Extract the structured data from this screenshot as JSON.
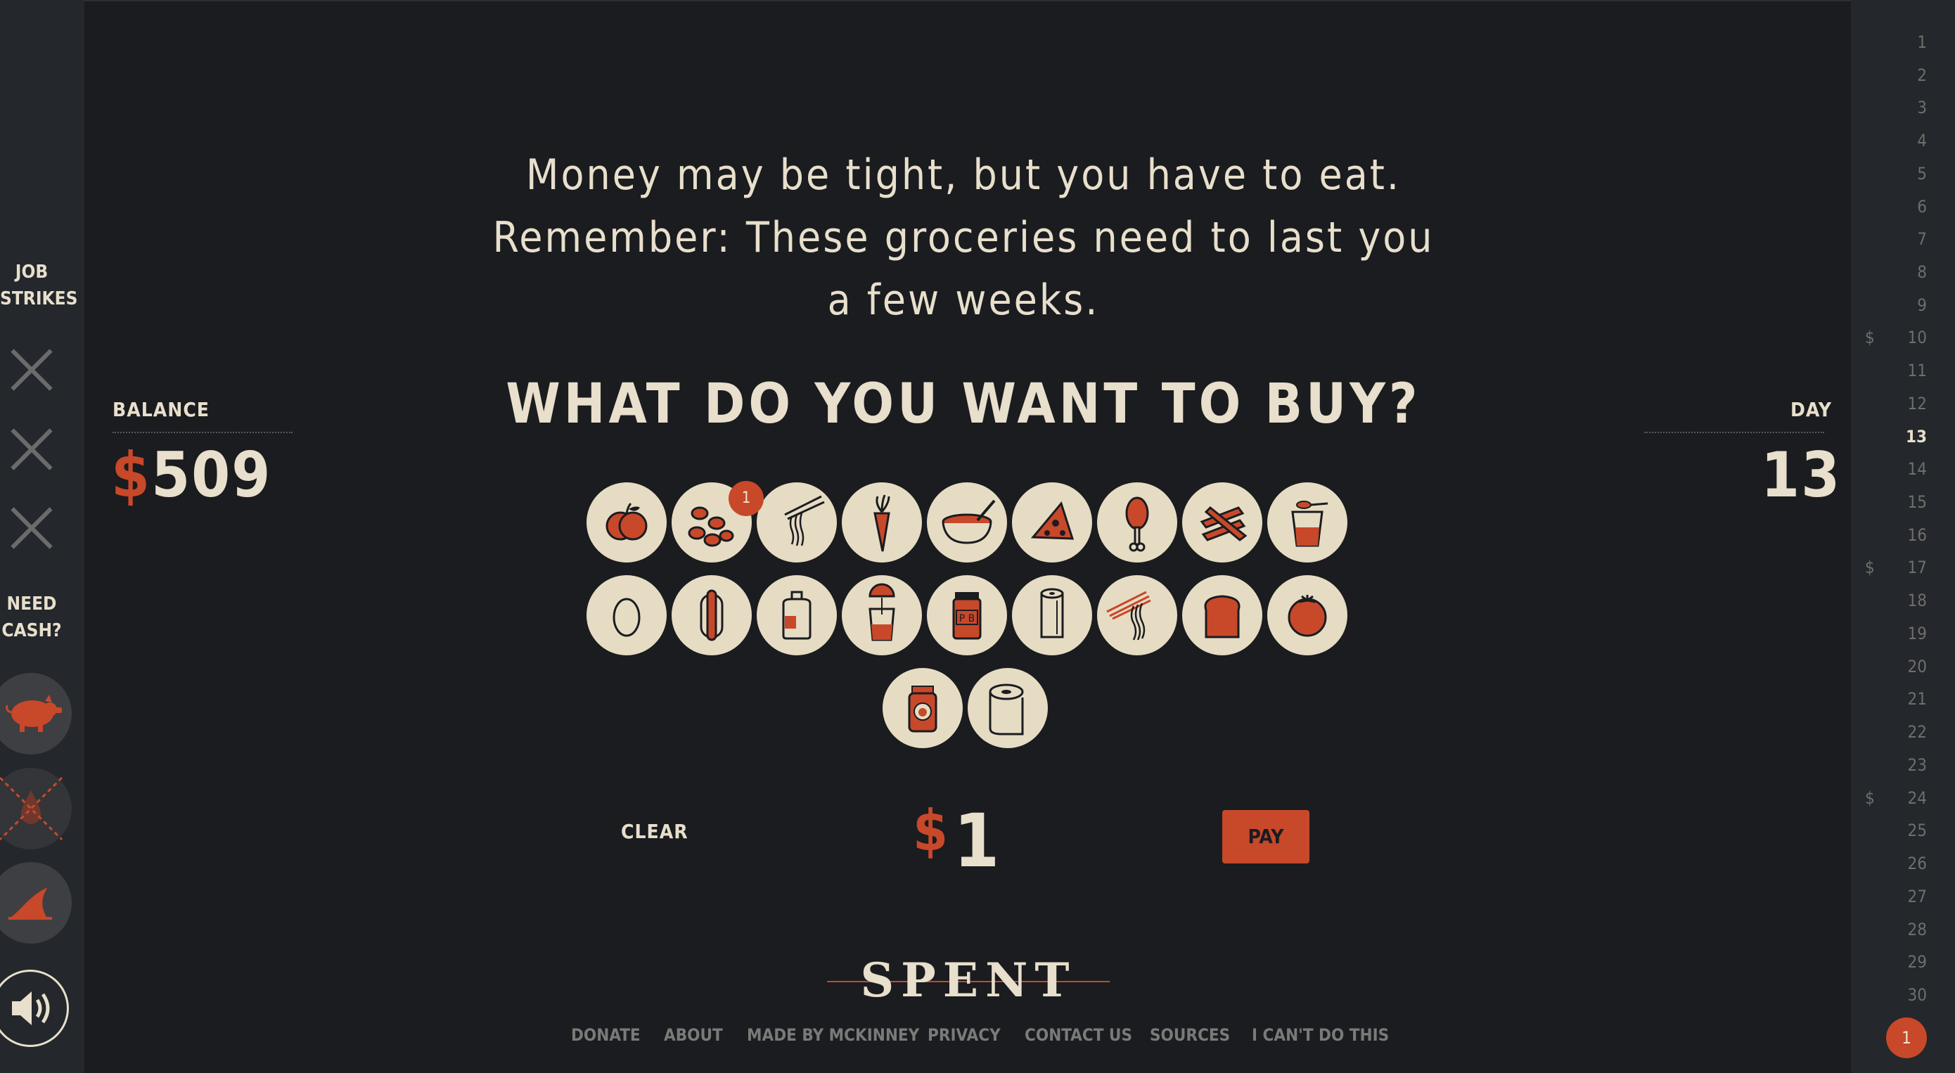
{
  "sidebar_left": {
    "job_strikes_label_line1": "JOB",
    "job_strikes_label_line2": "STRIKES",
    "need_cash_label_line1": "NEED",
    "need_cash_label_line2": "CASH?",
    "cash_options": [
      "piggy-bank-icon",
      "blood-drop-icon",
      "shark-fin-icon"
    ],
    "sound_icon": "speaker-icon"
  },
  "balance": {
    "label": "BALANCE",
    "currency": "$",
    "amount": "509"
  },
  "day": {
    "label": "DAY",
    "value": "13"
  },
  "intro_text": "Money may be tight, but you have to eat. Remember: These groceries need to last you a few weeks.",
  "question": "WHAT DO YOU WANT TO BUY?",
  "items_row1": [
    "apple-icon",
    "beans-icon",
    "ramen-noodles-icon",
    "carrot-icon",
    "cereal-bowl-icon",
    "cheese-icon",
    "chicken-drumstick-icon",
    "bacon-icon",
    "oil-cup-icon"
  ],
  "items_row2": [
    "egg-icon",
    "hot-dog-icon",
    "milk-jug-icon",
    "orange-juice-icon",
    "peanut-butter-jar-icon",
    "paper-towel-icon",
    "spaghetti-icon",
    "bread-icon",
    "tomato-icon"
  ],
  "items_row3": [
    "jam-jar-icon",
    "toilet-paper-icon"
  ],
  "selected_item_quantity": "1",
  "cart": {
    "clear_label": "CLEAR",
    "currency": "$",
    "total": "1",
    "pay_label": "PAY"
  },
  "calendar": {
    "days": [
      "1",
      "2",
      "3",
      "4",
      "5",
      "6",
      "7",
      "8",
      "9",
      "10",
      "11",
      "12",
      "13",
      "14",
      "15",
      "16",
      "17",
      "18",
      "19",
      "20",
      "21",
      "22",
      "23",
      "24",
      "25",
      "26",
      "27",
      "28",
      "29",
      "30"
    ],
    "current_day": "13",
    "payday_marker": "$",
    "badge_count": "1"
  },
  "logo_text": "SPENT",
  "footer_links": [
    "DONATE",
    "ABOUT",
    "MADE BY MCKINNEY",
    "PRIVACY",
    "CONTACT US",
    "SOURCES",
    "I CAN'T DO THIS"
  ],
  "colors": {
    "background": "#1a1c1f",
    "sidebar": "#24272b",
    "cream": "#e8dfcc",
    "accent": "#c8482a",
    "muted": "#7a7a78"
  }
}
